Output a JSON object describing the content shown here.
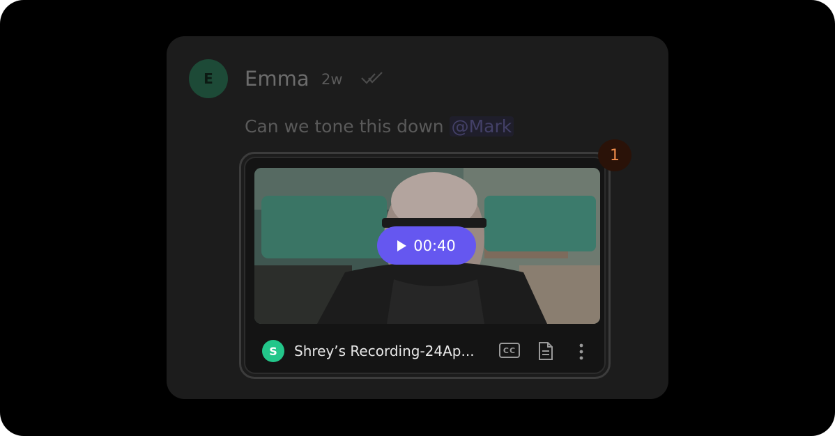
{
  "message": {
    "avatar_initial": "E",
    "author": "Emma",
    "time": "2w",
    "text": "Can we tone this down",
    "mention": "@Mark"
  },
  "video": {
    "duration": "00:40",
    "owner_initial": "S",
    "title": "Shrey’s Recording-24Ap...",
    "cc_label": "CC",
    "badge_count": "1"
  },
  "colors": {
    "play_button": "#6557f0",
    "owner_avatar": "#23c68a",
    "badge_text": "#f08d4c",
    "mention": "#434067"
  },
  "icons": [
    "read-receipt-icon",
    "play-icon",
    "cc-icon",
    "transcript-icon",
    "more-icon"
  ]
}
